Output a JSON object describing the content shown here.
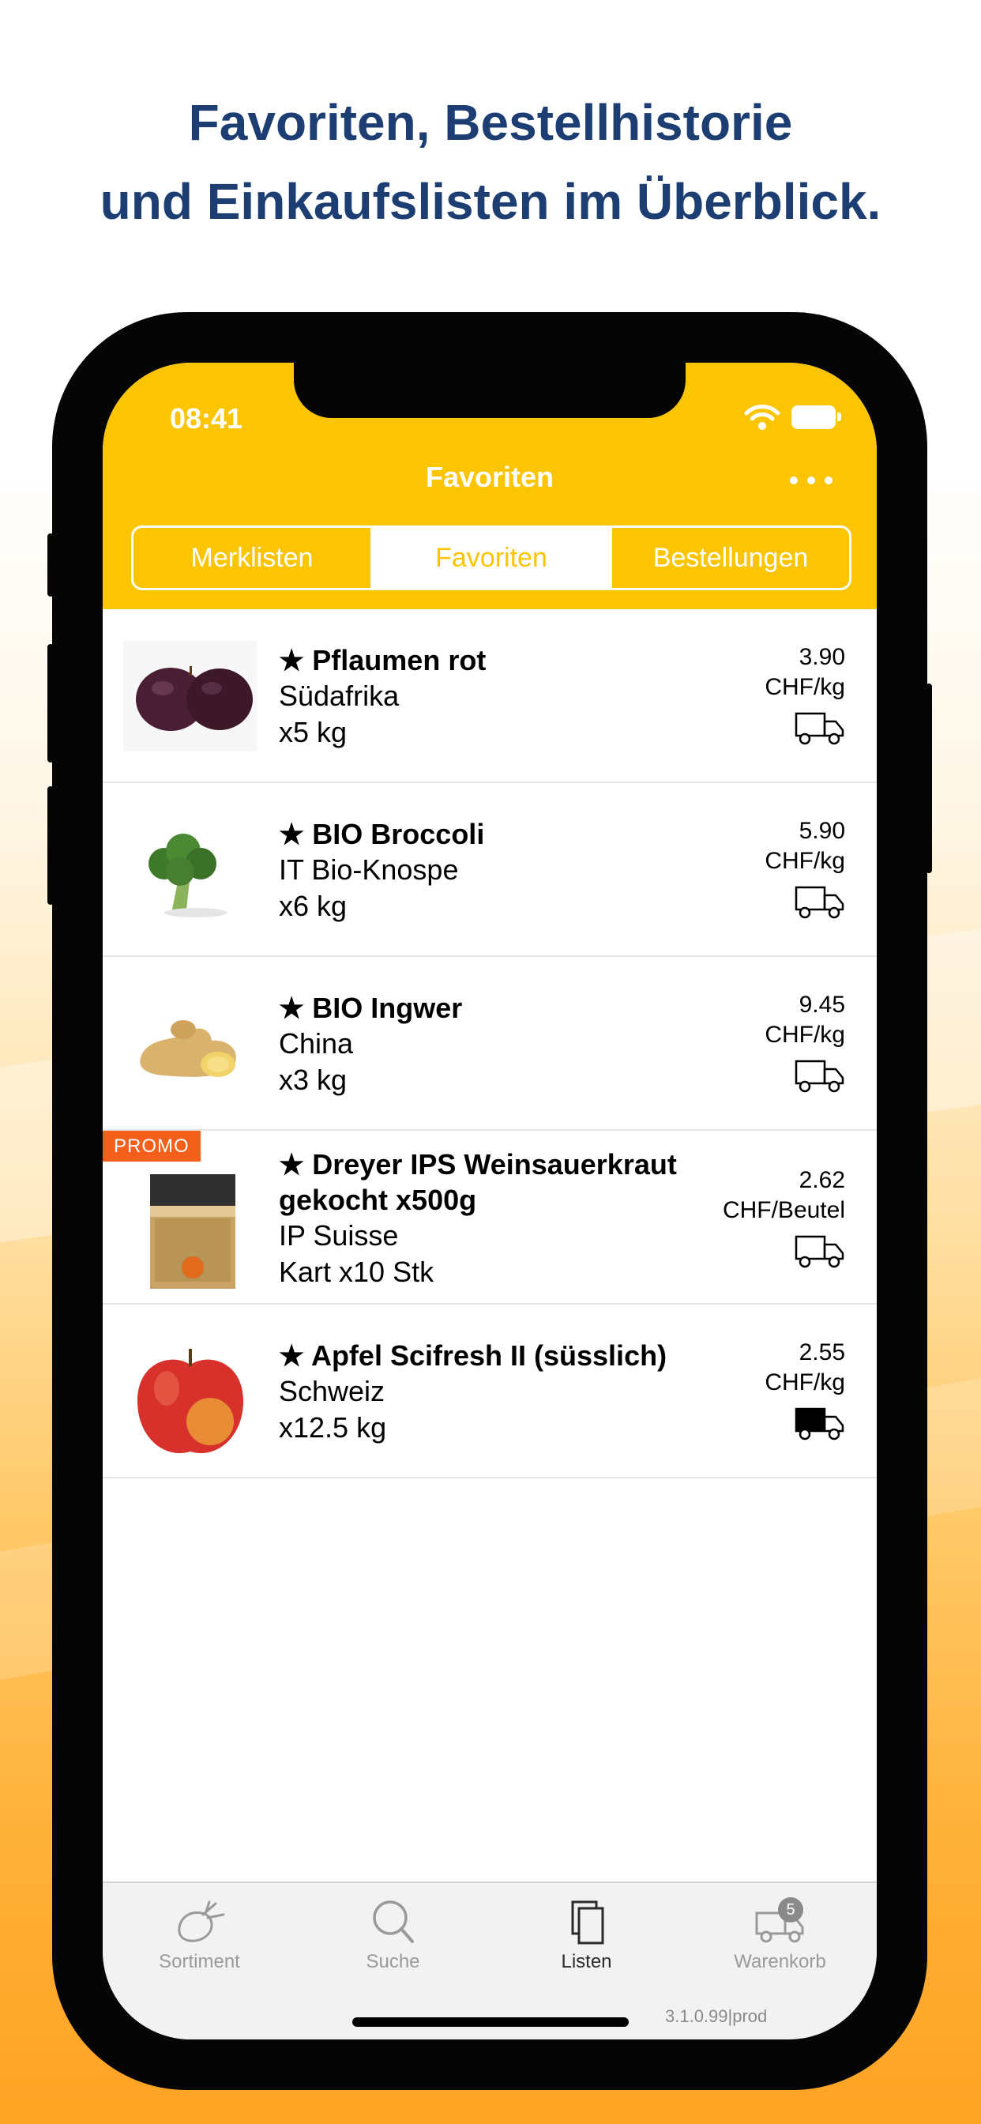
{
  "headline": {
    "line1": "Favoriten, Bestellhistorie",
    "line2": "und Einkaufslisten im Überblick."
  },
  "status_bar": {
    "time": "08:41"
  },
  "nav": {
    "title": "Favoriten"
  },
  "segments": [
    "Merklisten",
    "Favoriten",
    "Bestellungen"
  ],
  "items": [
    {
      "name": "★ Pflaumen rot",
      "origin": "Südafrika",
      "qty": "x5 kg",
      "price": "3.90",
      "unit": "CHF/kg",
      "promo": ""
    },
    {
      "name": "★ BIO Broccoli",
      "origin": "IT Bio-Knospe",
      "qty": "x6 kg",
      "price": "5.90",
      "unit": "CHF/kg",
      "promo": ""
    },
    {
      "name": "★ BIO Ingwer",
      "origin": "China",
      "qty": "x3 kg",
      "price": "9.45",
      "unit": "CHF/kg",
      "promo": ""
    },
    {
      "name": "★ Dreyer IPS Weinsauerkraut gekocht x500g",
      "origin": "IP Suisse",
      "qty": "Kart x10 Stk",
      "price": "2.62",
      "unit": "CHF/Beutel",
      "promo": "PROMO"
    },
    {
      "name": "★ Apfel Scifresh II (süsslich)",
      "origin": "Schweiz",
      "qty": "x12.5 kg",
      "price": "2.55",
      "unit": "CHF/kg",
      "promo": ""
    }
  ],
  "tabs": {
    "sortiment": "Sortiment",
    "suche": "Suche",
    "listen": "Listen",
    "warenkorb": "Warenkorb",
    "cart_count": "5"
  },
  "version": "3.1.0.99|prod",
  "colors": {
    "brand_yellow": "#fcc503",
    "promo_orange": "#f4601b",
    "headline_blue": "#1d3e73"
  }
}
